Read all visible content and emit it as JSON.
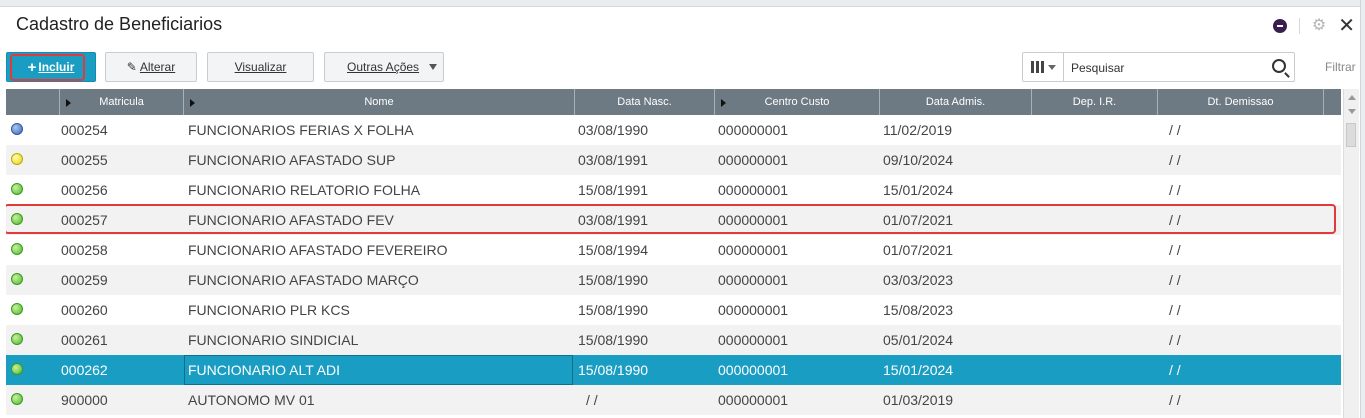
{
  "window": {
    "title": "Cadastro de Beneficiarios"
  },
  "toolbar": {
    "incluir_label": "Incluir",
    "alterar_label": "Alterar",
    "visualizar_label": "Visualizar",
    "outras_acoes_label": "Outras Ações",
    "search_placeholder": "Pesquisar",
    "filtrar_label": "Filtrar"
  },
  "colors": {
    "accent": "#1a9dc2",
    "header": "#6e7a83",
    "highlight": "#e03a3a"
  },
  "table": {
    "columns": [
      "",
      "Matricula",
      "Nome",
      "Data Nasc.",
      "Centro Custo",
      "Data Admis.",
      "Dep. I.R.",
      "Dt. Demissao"
    ],
    "rows": [
      {
        "status": "blue",
        "matricula": "000254",
        "nome": "FUNCIONARIOS FERIAS X FOLHA",
        "data_nasc": "03/08/1990",
        "centro_custo": "000000001",
        "data_admis": "11/02/2019",
        "dep_ir": "",
        "dt_demissao": "/ /"
      },
      {
        "status": "yellow",
        "matricula": "000255",
        "nome": "FUNCIONARIO AFASTADO SUP",
        "data_nasc": "03/08/1991",
        "centro_custo": "000000001",
        "data_admis": "09/10/2024",
        "dep_ir": "",
        "dt_demissao": "/ /"
      },
      {
        "status": "green",
        "matricula": "000256",
        "nome": "FUNCIONARIO RELATORIO FOLHA",
        "data_nasc": "15/08/1991",
        "centro_custo": "000000001",
        "data_admis": "15/01/2024",
        "dep_ir": "",
        "dt_demissao": "/ /"
      },
      {
        "status": "green",
        "matricula": "000257",
        "nome": "FUNCIONARIO AFASTADO FEV",
        "data_nasc": "03/08/1991",
        "centro_custo": "000000001",
        "data_admis": "01/07/2021",
        "dep_ir": "",
        "dt_demissao": "/ /"
      },
      {
        "status": "green",
        "matricula": "000258",
        "nome": "FUNCIONARIO AFASTADO FEVEREIRO",
        "data_nasc": "15/08/1994",
        "centro_custo": "000000001",
        "data_admis": "01/07/2021",
        "dep_ir": "",
        "dt_demissao": "/ /"
      },
      {
        "status": "green",
        "matricula": "000259",
        "nome": "FUNCIONARIO AFASTADO MARÇO",
        "data_nasc": "15/08/1990",
        "centro_custo": "000000001",
        "data_admis": "03/03/2023",
        "dep_ir": "",
        "dt_demissao": "/ /"
      },
      {
        "status": "green",
        "matricula": "000260",
        "nome": "FUNCIONARIO PLR KCS",
        "data_nasc": "15/08/1990",
        "centro_custo": "000000001",
        "data_admis": "15/08/2023",
        "dep_ir": "",
        "dt_demissao": "/ /"
      },
      {
        "status": "green",
        "matricula": "000261",
        "nome": "FUNCIONARIO SINDICIAL",
        "data_nasc": "15/08/1990",
        "centro_custo": "000000001",
        "data_admis": "05/01/2024",
        "dep_ir": "",
        "dt_demissao": "/ /"
      },
      {
        "status": "green",
        "matricula": "000262",
        "nome": "FUNCIONARIO ALT ADI",
        "data_nasc": "15/08/1990",
        "centro_custo": "000000001",
        "data_admis": "15/01/2024",
        "dep_ir": "",
        "dt_demissao": "/ /"
      },
      {
        "status": "green",
        "matricula": "900000",
        "nome": "AUTONOMO MV 01",
        "data_nasc": "/ /",
        "centro_custo": "000000001",
        "data_admis": "01/03/2019",
        "dep_ir": "",
        "dt_demissao": "/ /"
      }
    ],
    "selected_index": 8,
    "highlighted_index": 3
  }
}
